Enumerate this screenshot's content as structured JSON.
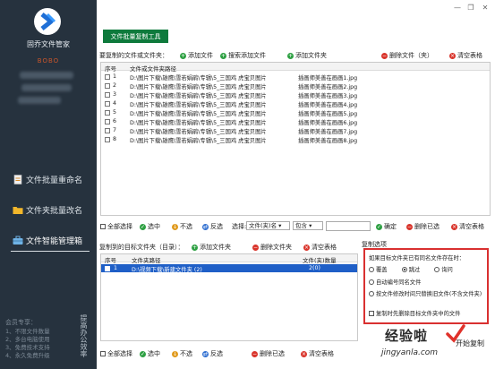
{
  "sidebar": {
    "app_name": "固乔文件管家",
    "user_name": "BOBO",
    "nav": [
      {
        "label": "文件批量重命名",
        "icon": "document-icon"
      },
      {
        "label": "文件夹批量改名",
        "icon": "folder-icon"
      },
      {
        "label": "文件智能管理箱",
        "icon": "toolbox-icon"
      }
    ],
    "promo_title": "会员专享：",
    "promo_lines": [
      "1、不限文件数量",
      "2、多台电脑使用",
      "3、免费技术支持",
      "4、永久免费升级"
    ],
    "vertical_text": "提高办公效率"
  },
  "main": {
    "tool_tab": "文件批量复制工具",
    "top_section": {
      "title": "要复制的文件或文件夹：",
      "buttons": [
        "添加文件",
        "搜索添加文件",
        "添加文件夹",
        "删除文件（夹）",
        "清空表格"
      ],
      "columns": [
        "序号",
        "文件或文件夹路径"
      ],
      "rows": [
        {
          "no": "1",
          "path": "D:\\图片下载\\雄鹰\\雪若娟鹃\\专辑\\5_三国鸡 虎宝贝图片",
          "name": "插画师美善在画画1.jpg"
        },
        {
          "no": "2",
          "path": "D:\\图片下载\\雄鹰\\雪若娟鹃\\专辑\\5_三国鸡 虎宝贝图片",
          "name": "插画师美善在画画2.jpg"
        },
        {
          "no": "3",
          "path": "D:\\图片下载\\雄鹰\\雪若娟鹃\\专辑\\5_三国鸡 虎宝贝图片",
          "name": "插画师美善在画画3.jpg"
        },
        {
          "no": "4",
          "path": "D:\\图片下载\\雄鹰\\雪若娟鹃\\专辑\\5_三国鸡 虎宝贝图片",
          "name": "插画师美善在画画4.jpg"
        },
        {
          "no": "5",
          "path": "D:\\图片下载\\雄鹰\\雪若娟鹃\\专辑\\5_三国鸡 虎宝贝图片",
          "name": "插画师美善在画画5.jpg"
        },
        {
          "no": "6",
          "path": "D:\\图片下载\\雄鹰\\雪若娟鹃\\专辑\\5_三国鸡 虎宝贝图片",
          "name": "插画师美善在画画6.jpg"
        },
        {
          "no": "7",
          "path": "D:\\图片下载\\雄鹰\\雪若娟鹃\\专辑\\5_三国鸡 虎宝贝图片",
          "name": "插画师美善在画画7.jpg"
        },
        {
          "no": "8",
          "path": "D:\\图片下载\\雄鹰\\雪若娟鹃\\专辑\\5_三国鸡 虎宝贝图片",
          "name": "插画师美善在画画8.jpg"
        }
      ],
      "bottom_bar": {
        "select_all": "全部选择",
        "select": "选中",
        "deselect": "不选",
        "invert": "反选",
        "choose_label": "选择:",
        "field_value": "文件(夹)名",
        "match_value": "包含",
        "confirm": "确定",
        "delete_selected": "删除已选",
        "clear": "清空表格"
      }
    },
    "target_section": {
      "title": "复制到的目标文件夹（目录）：",
      "buttons": [
        "添加文件夹",
        "删除文件夹",
        "清空表格"
      ],
      "columns": [
        "序号",
        "文件夹路径",
        "文件(夹)数量"
      ],
      "rows": [
        {
          "no": "1",
          "path": "D:\\视频下载\\新建文件夹 (2)",
          "count": "2(0)"
        }
      ],
      "bottom_bar": {
        "select_all": "全部选择",
        "select": "选中",
        "deselect": "不选",
        "invert": "反选",
        "delete_selected": "删除已选",
        "clear": "清空表格"
      }
    },
    "copy_options": {
      "title": "复制选项",
      "question": "如果目标文件夹已有同名文件存在时：",
      "radio_options": [
        "覆盖",
        "跳过",
        "询问"
      ],
      "selected": "跳过",
      "option_auto_number": "自动编号同名文件",
      "option_time": "按文件修改时间只替换旧文件(不含文件夹)",
      "option_clear": "复制时先删除目标文件夹中的文件"
    },
    "watermark": {
      "cn": "经验啦",
      "en": "jingyanla.com"
    },
    "start_copy": "开始复制"
  }
}
